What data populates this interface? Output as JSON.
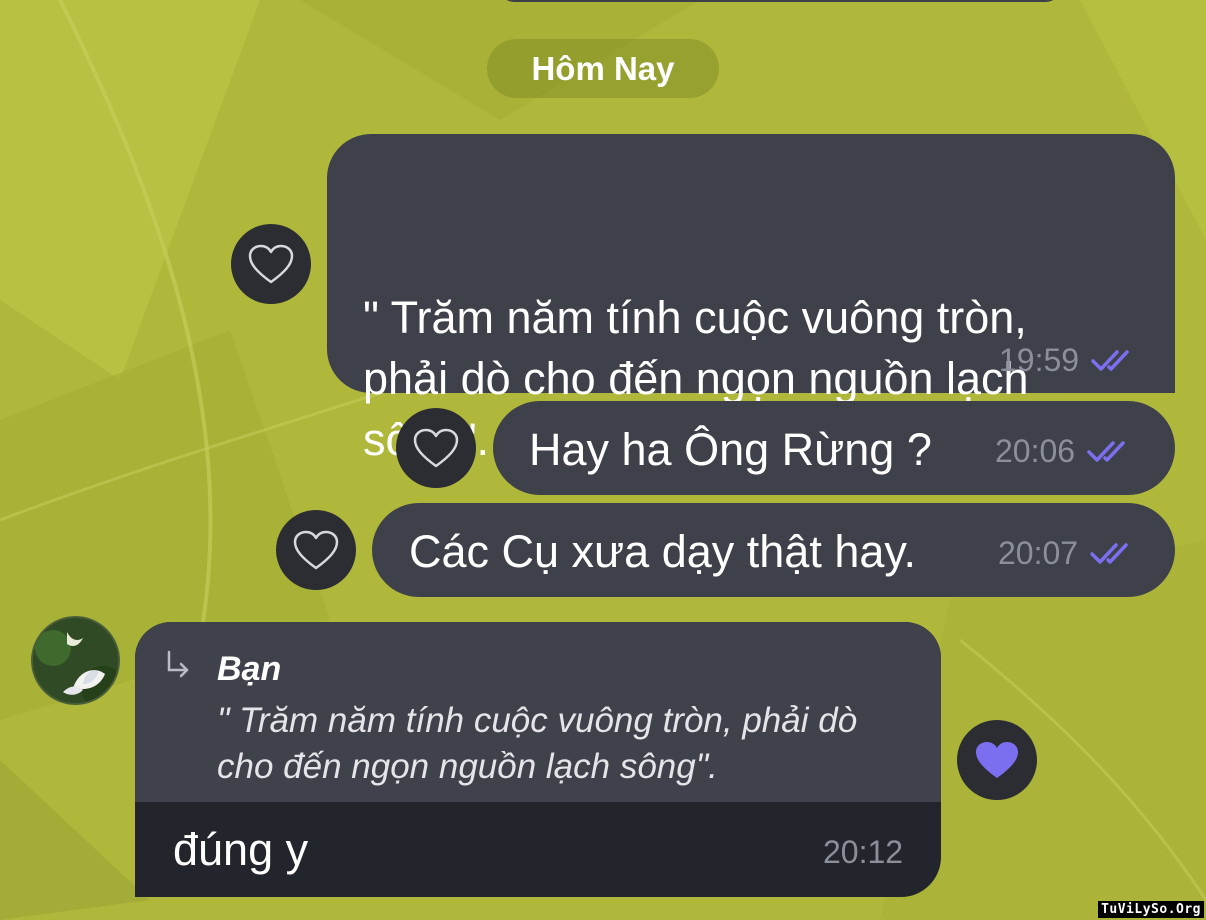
{
  "date_divider": "Hôm Nay",
  "messages": [
    {
      "lines": [
        "\" Trăm năm tính cuộc vuông tròn,",
        "phải dò cho đến ngọn nguồn lạch",
        "sông\"."
      ],
      "time": "19:59"
    },
    {
      "text": "Hay ha Ông Rừng ?",
      "time": "20:06"
    },
    {
      "text": "Các Cụ xưa dạy thật hay.",
      "time": "20:07"
    }
  ],
  "reply": {
    "quoted_sender": "Bạn",
    "quoted_text": "\" Trăm năm tính cuộc vuông tròn, phải dò cho đến ngọn nguồn lạch sông\".",
    "text": "đúng y",
    "time": "20:12"
  },
  "watermark": "TuViLySo.Org",
  "icons": {
    "reaction_empty": "heart-outline-icon",
    "reaction_filled": "heart-filled-icon",
    "read_receipt": "double-check-icon",
    "reply": "reply-arrow-icon"
  },
  "colors": {
    "wallpaper": "#b0b83c",
    "bubble": "#3e4149",
    "reply_bubble": "#22252b",
    "read_ticks": "#7b6ff0",
    "reaction_filled": "#7b6ff0"
  }
}
